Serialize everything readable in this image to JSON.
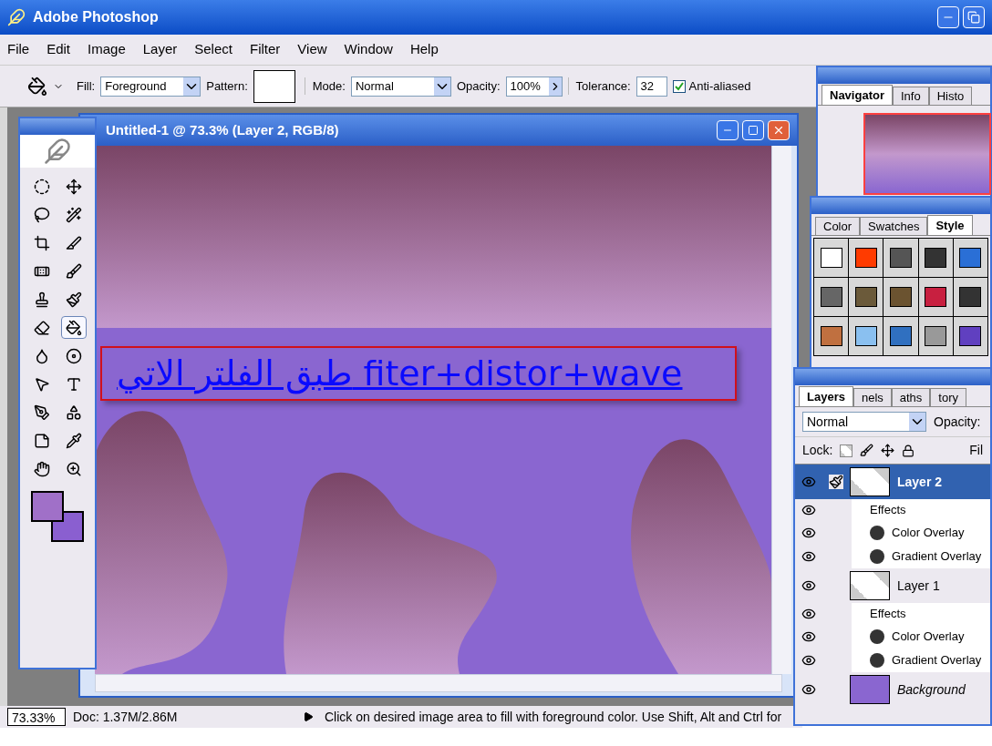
{
  "app": {
    "title": "Adobe Photoshop"
  },
  "menu": [
    "File",
    "Edit",
    "Image",
    "Layer",
    "Select",
    "Filter",
    "View",
    "Window",
    "Help"
  ],
  "options_bar": {
    "fill_label": "Fill:",
    "fill_value": "Foreground",
    "pattern_label": "Pattern:",
    "mode_label": "Mode:",
    "mode_value": "Normal",
    "opacity_label": "Opacity:",
    "opacity_value": "100%",
    "tolerance_label": "Tolerance:",
    "tolerance_value": "32",
    "anti_aliased": {
      "label": "Anti-aliased",
      "checked": true
    }
  },
  "toolbox": {
    "tools": [
      {
        "selected": false
      },
      {
        "selected": false
      },
      {
        "selected": false
      },
      {
        "selected": false
      },
      {
        "selected": false
      },
      {
        "selected": false
      },
      {
        "selected": false
      },
      {
        "selected": false
      },
      {
        "selected": false
      },
      {
        "selected": false
      },
      {
        "selected": false
      },
      {
        "selected": true
      },
      {
        "selected": false
      },
      {
        "selected": false
      },
      {
        "selected": false
      },
      {
        "selected": false
      },
      {
        "selected": false
      },
      {
        "selected": false
      },
      {
        "selected": false
      },
      {
        "selected": false
      },
      {
        "selected": false
      },
      {
        "selected": false
      }
    ],
    "color_swatches": [
      {
        "color": "#a070c8"
      },
      {
        "color": "#8a5fd0"
      }
    ]
  },
  "document": {
    "title": "Untitled-1 @ 73.3% (Layer 2, RGB/8)",
    "link_text": "طبق الفلتر الاتي fiter+distor+wave"
  },
  "navigator": {
    "tabs": [
      {
        "label": "Navigator",
        "selected": true
      },
      {
        "label": "Info",
        "selected": false
      },
      {
        "label": "Histo",
        "selected": false
      }
    ]
  },
  "styles": {
    "tabs": [
      {
        "label": "Color",
        "selected": false
      },
      {
        "label": "Swatches",
        "selected": false
      },
      {
        "label": "Style",
        "selected": true
      }
    ]
  },
  "layers_panel": {
    "tabs": [
      {
        "label": "Layers",
        "selected": true
      },
      {
        "label": "nels",
        "selected": false
      },
      {
        "label": "aths",
        "selected": false
      },
      {
        "label": "tory",
        "selected": false
      }
    ],
    "blend_mode": "Normal",
    "opacity_label": "Opacity:",
    "lock_label": "Lock:",
    "fill_label": "Fil",
    "layers": [
      {
        "name": "Layer 2",
        "kind": "layer",
        "selected": true,
        "visible": true,
        "effects_label": "Effects",
        "effects": [
          {
            "name": "Color Overlay",
            "visible": true
          },
          {
            "name": "Gradient Overlay",
            "visible": true
          }
        ]
      },
      {
        "name": "Layer 1",
        "kind": "layer",
        "selected": false,
        "visible": true,
        "effects_label": "Effects",
        "effects": [
          {
            "name": "Color Overlay",
            "visible": true
          },
          {
            "name": "Gradient Overlay",
            "visible": true
          }
        ]
      },
      {
        "name": "Background",
        "kind": "background",
        "selected": false,
        "visible": true
      }
    ]
  },
  "status_bar": {
    "zoom": "73.33%",
    "doc": "Doc: 1.37M/2.86M",
    "hint": "Click on desired image area to fill with foreground color.  Use Shift, Alt and Ctrl for"
  }
}
